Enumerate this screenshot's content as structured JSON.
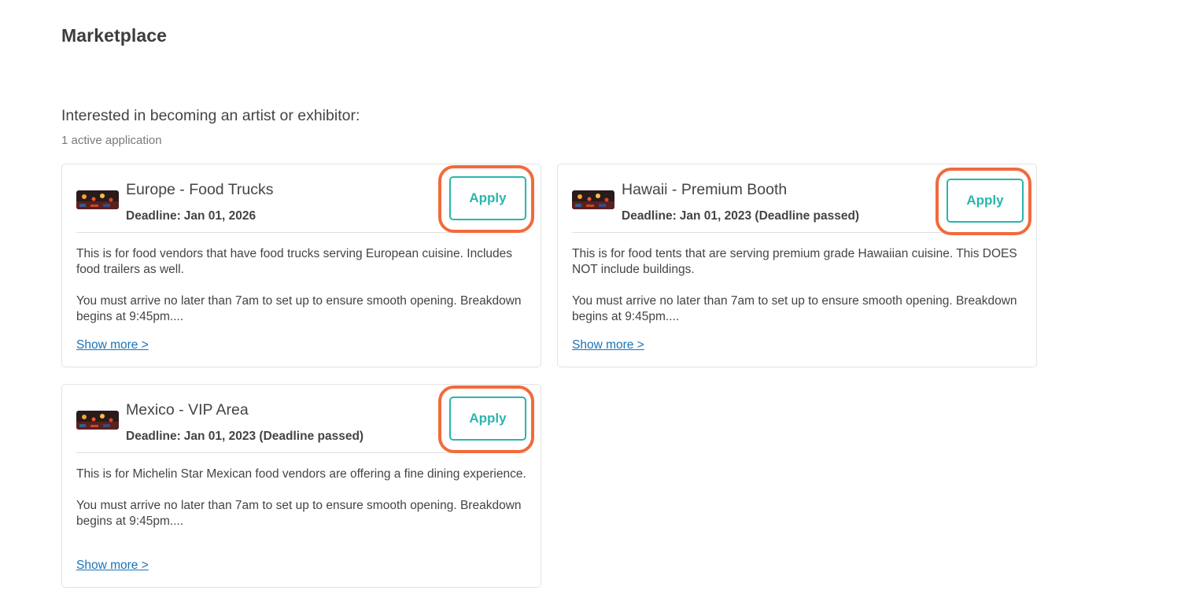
{
  "page": {
    "title": "Marketplace"
  },
  "section": {
    "heading": "Interested in becoming an artist or exhibitor:",
    "count_text": "1 active application"
  },
  "cards": [
    {
      "title": "Europe - Food Trucks",
      "deadline_label": "Deadline:",
      "deadline_value": "Jan 01, 2026",
      "description": [
        "This is for food vendors that have food trucks serving European cuisine. Includes food trailers as well.",
        "You must arrive no later than 7am to set up to ensure smooth opening. Breakdown begins at 9:45pm...."
      ],
      "apply_label": "Apply",
      "show_more_label": "Show more >",
      "highlighted": true
    },
    {
      "title": "Hawaii - Premium Booth",
      "deadline_label": "Deadline:",
      "deadline_value": "Jan 01, 2023 (Deadline passed)",
      "description": [
        "This is for food tents that are serving premium grade Hawaiian cuisine. This DOES NOT include buildings.",
        "You must arrive no later than 7am to set up to ensure smooth opening. Breakdown begins at 9:45pm...."
      ],
      "apply_label": "Apply",
      "show_more_label": "Show more >",
      "highlighted": true
    },
    {
      "title": "Mexico - VIP Area",
      "deadline_label": "Deadline:",
      "deadline_value": "Jan 01, 2023 (Deadline passed)",
      "description": [
        "This is for Michelin Star Mexican food vendors are offering a fine dining experience.",
        "You must arrive no later than 7am to set up to ensure smooth opening. Breakdown begins at 9:45pm...."
      ],
      "apply_label": "Apply",
      "show_more_label": "Show more >",
      "highlighted": true
    }
  ],
  "icons": {
    "card_thumbnail": "event-thumbnail-image"
  },
  "colors": {
    "accent_teal": "#2bb5ac",
    "highlight_orange": "#f26a3b",
    "link_blue": "#1a73b8",
    "text_dark": "#444444",
    "text_muted": "#7a7a7a",
    "card_border": "#e3e3e3"
  }
}
